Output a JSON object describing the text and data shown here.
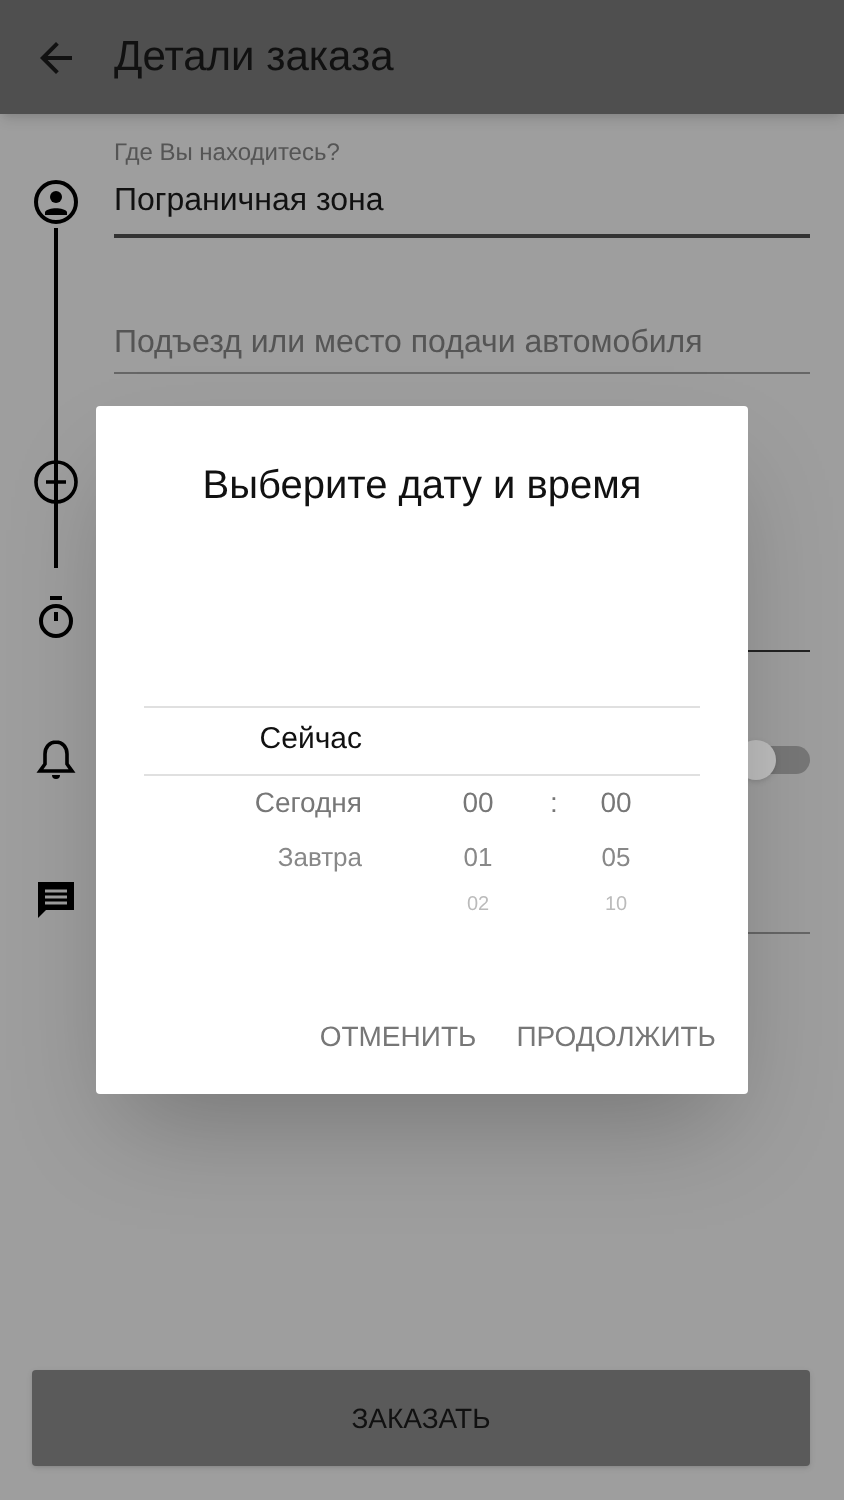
{
  "app_bar": {
    "title": "Детали заказа"
  },
  "form": {
    "pickup_label": "Где Вы находитесь?",
    "pickup_value": "Пограничная зона",
    "entrance_placeholder": "Подъезд или место подачи автомобиля",
    "notifications_toggle": {
      "on": false
    }
  },
  "dialog": {
    "title": "Выберите дату и время",
    "rows": [
      {
        "day": "Сейчас",
        "selected": true
      },
      {
        "day": "Сегодня",
        "hour": "00",
        "separator": ":",
        "minute": "00",
        "selected": false
      },
      {
        "day": "Завтра",
        "hour": "01",
        "minute": "05",
        "selected": false
      },
      {
        "hour": "02",
        "minute": "10",
        "selected": false
      }
    ],
    "buttons": [
      "ОТМЕНИТЬ",
      "ПРОДОЛЖИТЬ"
    ]
  },
  "order_button": "ЗАКАЗАТЬ"
}
